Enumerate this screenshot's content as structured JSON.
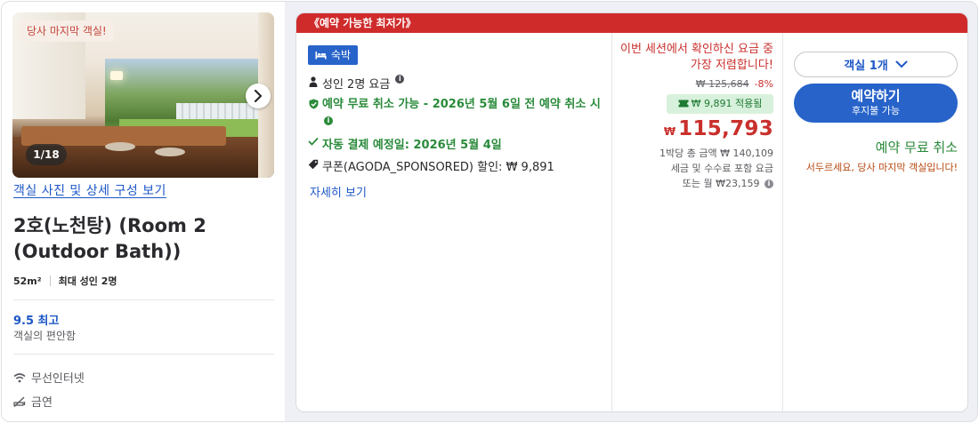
{
  "room": {
    "last_room_badge": "당사 마지막 객실!",
    "photo_counter": "1/18",
    "photos_link": "객실 사진 및 상세 구성 보기",
    "name": "2호(노천탕) (Room 2 (Outdoor Bath))",
    "size": "52m²",
    "max_guests": "최대 성인 2명",
    "rating_score": "9.5 최고",
    "rating_label": "객실의 편안함",
    "amenities": [
      "무선인터넷",
      "금연"
    ]
  },
  "offer": {
    "ribbon": "《예약 가능한 최저가》",
    "stay_tag": "숙박",
    "guests_rate": "성인 2명 요금",
    "free_cancel_policy": "예약 무료 취소 가능 - 2026년 5월 6일 전 예약 취소 시",
    "auto_payment": "자동 결제 예정일: 2026년 5월 4일",
    "coupon": "쿠폰(AGODA_SPONSORED) 할인: ₩ 9,891",
    "details_link": "자세히 보기"
  },
  "price": {
    "note": "이번 세션에서 확인하신 요금 중 가장 저렴합니다!",
    "original": "₩ 125,684",
    "discount": "-8%",
    "coupon_applied": "₩ 9,891 적용됨",
    "currency": "₩",
    "current": "115,793",
    "per_night_total": "1박당 총 금액 ₩ 140,109",
    "tax_included": "세금 및 수수료 포함 요금",
    "monthly": "또는 월 ₩23,159"
  },
  "booking": {
    "room_count": "객실 1개",
    "book_button": "예약하기",
    "book_button_sub": "후지불 가능",
    "free_cancel": "예약 무료 취소",
    "hurry": "서두르세요, 당사 마지막 객실입니다!"
  },
  "colors": {
    "brand_blue": "#2763c9",
    "ribbon_red": "#cf2b2b",
    "price_red": "#c9302c",
    "success_green": "#2a8a3a"
  }
}
